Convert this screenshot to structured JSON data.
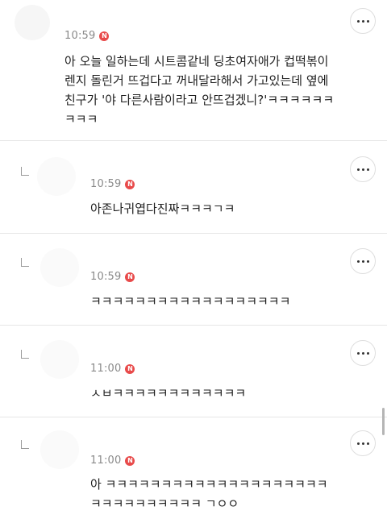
{
  "comments": [
    {
      "time": "10:59",
      "badge": "N",
      "text": "아 오늘 일하는데 시트콤같네 딩초여자애가 컵떡볶이\n렌지 돌린거 뜨겁다고 꺼내달라해서 가고있는데 옆에\n친구가 '야 다른사람이라고 안뜨겁겠니?'ㅋㅋㅋㅋㅋㅋ\nㅋㅋㅋ",
      "is_reply": false,
      "icons": {
        "more": "more-options-icon"
      }
    },
    {
      "time": "10:59",
      "badge": "N",
      "text": "아존나귀엽다진짜ㅋㅋㅋㄱㅋ",
      "is_reply": true,
      "icons": {
        "reply": "reply-arrow-icon",
        "more": "more-options-icon"
      }
    },
    {
      "time": "10:59",
      "badge": "N",
      "text": "ㅋㅋㅋㅋㅋㅋㅋㅋㅋㅋㅋㅋㅋㅋㅋㅋㅋㅋ",
      "is_reply": true,
      "icons": {
        "reply": "reply-arrow-icon",
        "more": "more-options-icon"
      }
    },
    {
      "time": "11:00",
      "badge": "N",
      "text": "ㅅㅂㅋㅋㅋㅋㅋㅋㅋㅋㅋㅋㅋㅋ",
      "is_reply": true,
      "icons": {
        "reply": "reply-arrow-icon",
        "more": "more-options-icon"
      }
    },
    {
      "time": "11:00",
      "badge": "N",
      "text": "아 ㅋㅋㅋㅋㅋㅋㅋㅋㅋㅋㅋㅋㅋㅋㅋㅋㅋㅋㅋㅋ\nㅋㅋㅋㅋㅋㅋㅋㅋㅋㅋ ㄱㅇㅇ",
      "is_reply": true,
      "icons": {
        "reply": "reply-arrow-icon",
        "more": "more-options-icon"
      }
    }
  ],
  "colors": {
    "badge": "#e84a4a",
    "time": "#8a8a8a",
    "text": "#222222",
    "divider": "#e6e6e6"
  }
}
